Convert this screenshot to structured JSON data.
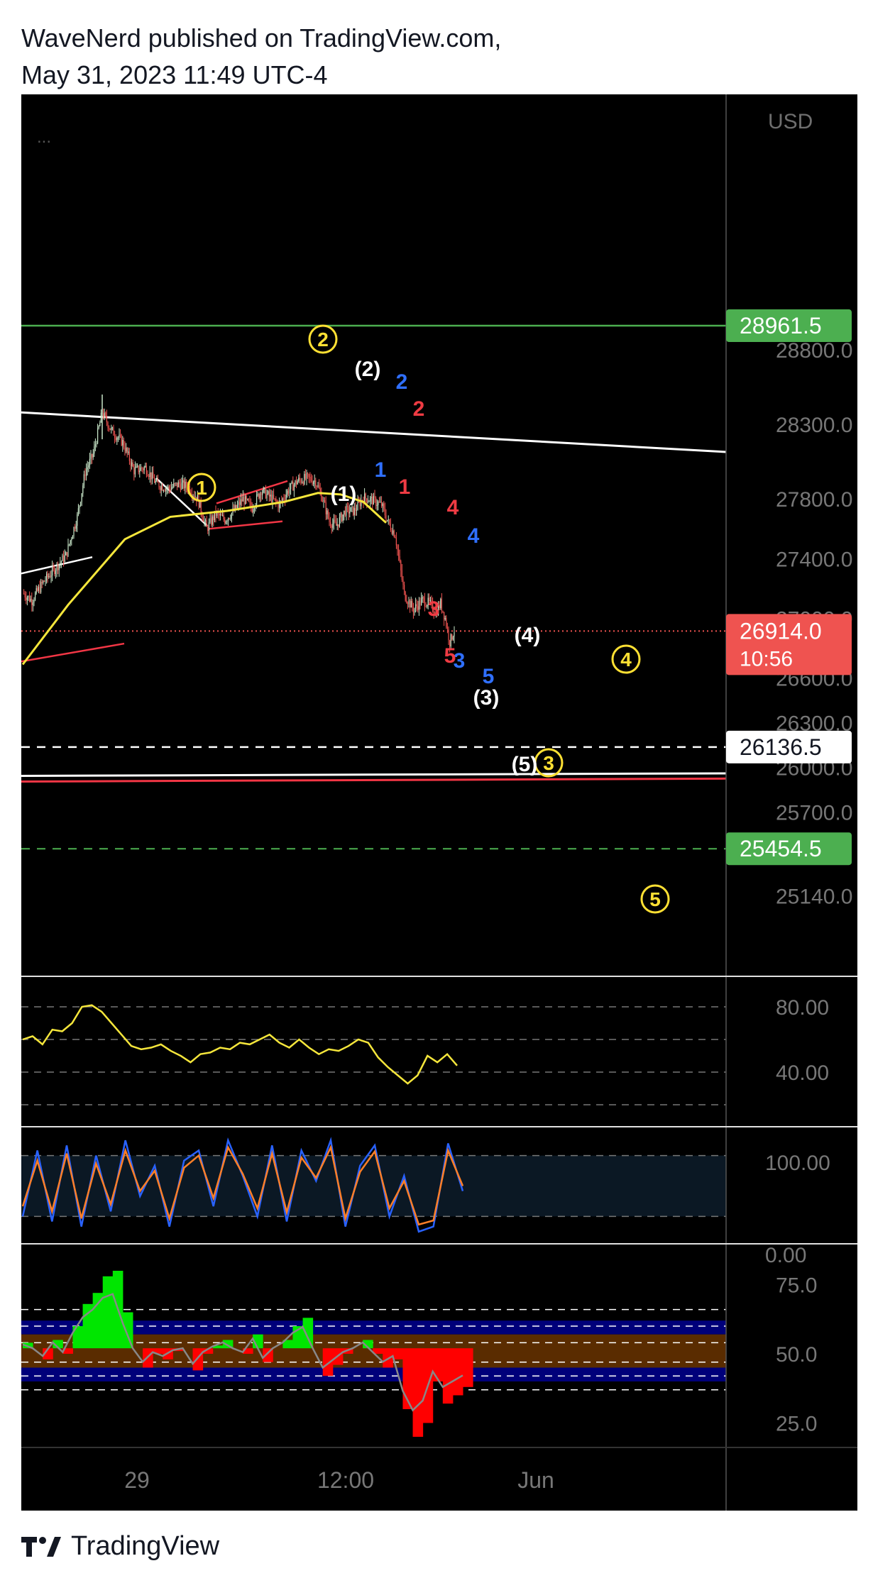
{
  "header": {
    "line1": "WaveNerd published on TradingView.com,",
    "line2": "May 31, 2023 11:49 UTC-4"
  },
  "footer": {
    "brand": "TradingView"
  },
  "colors": {
    "background": "#000000",
    "candle_up": "#c8e6c9",
    "candle_down": "#ef5350",
    "ma": "#f5e63b",
    "green_badge": "#4caf50",
    "red_badge": "#ef5350",
    "white_line": "#ffffff",
    "red_line": "#f23645",
    "rsi": "#f5e63b",
    "stoch_k": "#2962ff",
    "stoch_d": "#ff7f27",
    "osc_up": "#00e600",
    "osc_down": "#ff0000",
    "band_blue": "#00007a",
    "band_brown": "#5a2c00",
    "label_blue": "#2f6fff",
    "label_red": "#ef3b43",
    "label_yellow": "#ffe033"
  },
  "price_axis": {
    "currency": "USD",
    "menu_dots": "...",
    "ticks": [
      "28800.0",
      "28300.0",
      "27800.0",
      "27400.0",
      "27000.0",
      "26600.0",
      "26300.0",
      "26000.0",
      "25700.0",
      "25140.0"
    ]
  },
  "badges": {
    "upper_target": "28961.5",
    "current_price": "26914.0",
    "countdown": "10:56",
    "dashed_level": "26136.5",
    "lower_target": "25454.5"
  },
  "time_axis": {
    "labels": [
      "29",
      "12:00",
      "Jun"
    ]
  },
  "rsi_axis": {
    "ticks": [
      "80.00",
      "40.00"
    ]
  },
  "stoch_axis": {
    "ticks": [
      "100.00",
      "0.00"
    ]
  },
  "osc_axis": {
    "ticks": [
      "75.0",
      "50.0",
      "25.0"
    ]
  },
  "wave_labels": {
    "yellow": [
      "1",
      "2",
      "3",
      "4",
      "5"
    ],
    "white": [
      "(1)",
      "(2)",
      "(3)",
      "(4)",
      "(5)"
    ],
    "blue": [
      "1",
      "2",
      "3",
      "4",
      "5"
    ],
    "red": [
      "1",
      "2",
      "3",
      "4",
      "5"
    ]
  },
  "chart_data": {
    "type": "candlestick",
    "title": "",
    "currency": "USD",
    "ylim": [
      25140,
      29050
    ],
    "price_path": [
      [
        0,
        27170
      ],
      [
        8,
        27120
      ],
      [
        18,
        27240
      ],
      [
        28,
        27330
      ],
      [
        38,
        27420
      ],
      [
        48,
        27680
      ],
      [
        55,
        27980
      ],
      [
        62,
        28100
      ],
      [
        70,
        28380
      ],
      [
        78,
        28260
      ],
      [
        88,
        28180
      ],
      [
        98,
        27990
      ],
      [
        108,
        28010
      ],
      [
        118,
        27900
      ],
      [
        128,
        27870
      ],
      [
        138,
        27900
      ],
      [
        146,
        27880
      ],
      [
        154,
        27800
      ],
      [
        162,
        27600
      ],
      [
        170,
        27700
      ],
      [
        178,
        27660
      ],
      [
        186,
        27720
      ],
      [
        194,
        27800
      ],
      [
        202,
        27740
      ],
      [
        210,
        27860
      ],
      [
        218,
        27810
      ],
      [
        226,
        27760
      ],
      [
        234,
        27860
      ],
      [
        242,
        27920
      ],
      [
        250,
        27940
      ],
      [
        258,
        27920
      ],
      [
        264,
        27800
      ],
      [
        270,
        27650
      ],
      [
        276,
        27620
      ],
      [
        284,
        27720
      ],
      [
        292,
        27720
      ],
      [
        300,
        27810
      ],
      [
        308,
        27790
      ],
      [
        316,
        27760
      ],
      [
        322,
        27640
      ],
      [
        328,
        27560
      ],
      [
        336,
        27160
      ],
      [
        344,
        27060
      ],
      [
        352,
        27120
      ],
      [
        358,
        27100
      ],
      [
        364,
        27040
      ],
      [
        368,
        27100
      ],
      [
        372,
        27000
      ],
      [
        376,
        26840
      ],
      [
        380,
        26920
      ]
    ],
    "ma_path": [
      [
        0,
        26690
      ],
      [
        40,
        27090
      ],
      [
        90,
        27530
      ],
      [
        130,
        27680
      ],
      [
        180,
        27720
      ],
      [
        230,
        27780
      ],
      [
        260,
        27840
      ],
      [
        280,
        27830
      ],
      [
        300,
        27780
      ],
      [
        320,
        27640
      ]
    ],
    "levels": [
      {
        "name": "upper target",
        "value": 28961.5
      },
      {
        "name": "current price",
        "value": 26914.0
      },
      {
        "name": "dashed level",
        "value": 26136.5
      },
      {
        "name": "lower target",
        "value": 25454.5
      }
    ],
    "rsi": {
      "guides": [
        80,
        60,
        40
      ],
      "values": [
        60,
        62,
        57,
        66,
        65,
        70,
        80,
        81,
        77,
        70,
        63,
        56,
        54,
        55,
        57,
        53,
        50,
        46,
        51,
        52,
        55,
        54,
        58,
        57,
        60,
        63,
        58,
        55,
        60,
        55,
        51,
        54,
        53,
        56,
        60,
        58,
        49,
        43,
        38,
        33,
        38,
        50,
        46,
        51,
        44
      ]
    },
    "stoch": {
      "band": [
        80,
        20
      ],
      "k": [
        20,
        85,
        15,
        90,
        10,
        80,
        25,
        95,
        40,
        70,
        10,
        75,
        85,
        30,
        95,
        60,
        20,
        90,
        15,
        85,
        55,
        95,
        10,
        70,
        90,
        20,
        60,
        5,
        10,
        92,
        45
      ],
      "d": [
        30,
        75,
        25,
        82,
        18,
        72,
        32,
        85,
        45,
        65,
        18,
        68,
        80,
        38,
        88,
        62,
        28,
        82,
        24,
        78,
        58,
        88,
        18,
        64,
        84,
        28,
        55,
        12,
        16,
        85,
        50
      ]
    },
    "oscillator": {
      "levels": [
        66,
        60,
        54,
        47,
        42,
        37
      ],
      "band_blue": [
        [
          57,
          62
        ],
        [
          40,
          45
        ]
      ],
      "band_brown": [
        45,
        57
      ],
      "values": [
        54,
        52,
        48,
        55,
        50,
        60,
        68,
        72,
        78,
        80,
        65,
        52,
        45,
        50,
        48,
        51,
        52,
        44,
        50,
        53,
        55,
        52,
        50,
        57,
        47,
        52,
        55,
        60,
        63,
        52,
        42,
        46,
        50,
        52,
        55,
        50,
        45,
        48,
        30,
        20,
        25,
        40,
        32,
        35,
        38
      ]
    }
  }
}
